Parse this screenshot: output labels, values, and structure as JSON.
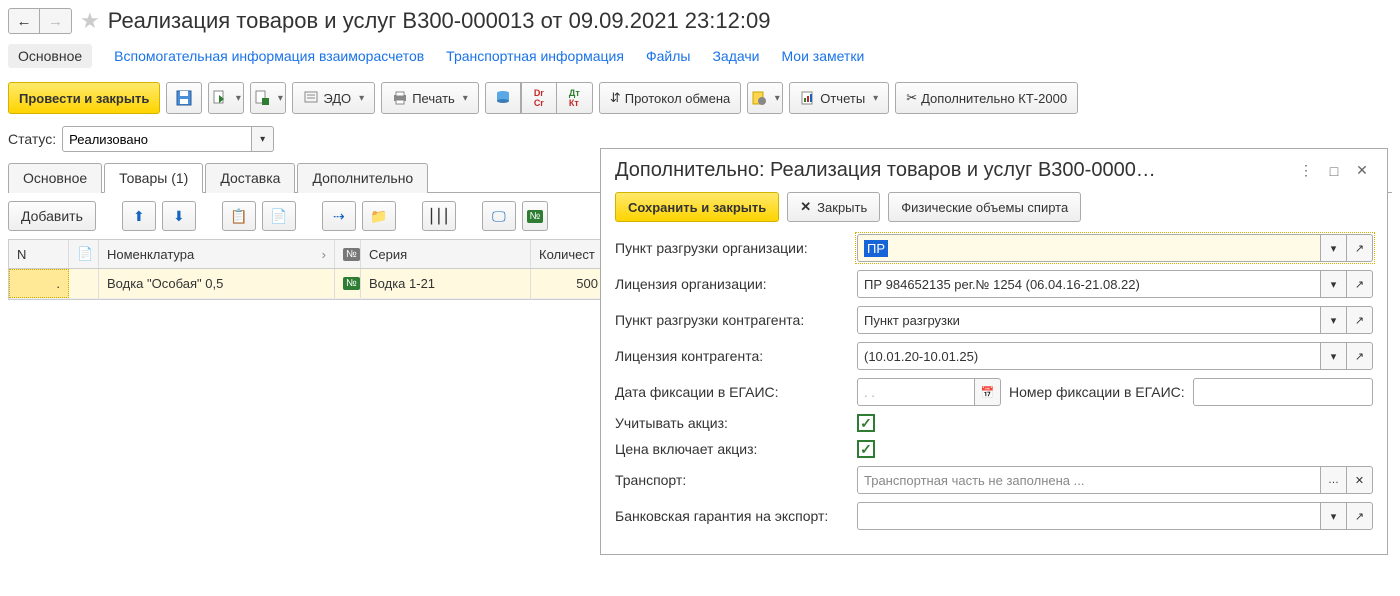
{
  "header": {
    "title": "Реализация товаров и услуг В300-000013 от 09.09.2021 23:12:09"
  },
  "linkTabs": {
    "main": "Основное",
    "aux": "Вспомогательная информация взаиморасчетов",
    "transport": "Транспортная информация",
    "files": "Файлы",
    "tasks": "Задачи",
    "notes": "Мои заметки"
  },
  "toolbar": {
    "postAndClose": "Провести и закрыть",
    "edo": "ЭДО",
    "print": "Печать",
    "protocol": "Протокол обмена",
    "reports": "Отчеты",
    "extKT": "Дополнительно КТ-2000"
  },
  "status": {
    "label": "Статус:",
    "value": "Реализовано"
  },
  "mainTabs": {
    "t1": "Основное",
    "t2": "Товары (1)",
    "t3": "Доставка",
    "t4": "Дополнительно"
  },
  "gridToolbar": {
    "add": "Добавить"
  },
  "gridHeader": {
    "n": "N",
    "nom": "Номенклатура",
    "ser": "Серия",
    "qty": "Количест"
  },
  "gridRow": {
    "n": ".",
    "nom": "Водка \"Особая\" 0,5",
    "ser": "Водка 1-21",
    "qty": "500"
  },
  "panel": {
    "title": "Дополнительно: Реализация товаров и услуг В300-0000…",
    "saveClose": "Сохранить и закрыть",
    "close": "Закрыть",
    "physVol": "Физические объемы спирта",
    "f1": {
      "label": "Пункт разгрузки организации:",
      "value": "ПР"
    },
    "f2": {
      "label": "Лицензия организации:",
      "value": "ПР 984652135 рег.№ 1254 (06.04.16-21.08.22)"
    },
    "f3": {
      "label": "Пункт разгрузки контрагента:",
      "value": "Пункт разгрузки"
    },
    "f4": {
      "label": "Лицензия контрагента:",
      "value": "(10.01.20-10.01.25)"
    },
    "f5": {
      "label": "Дата фиксации в ЕГАИС:",
      "value": "  .  .    "
    },
    "f5b": {
      "label": "Номер фиксации в ЕГАИС:",
      "value": ""
    },
    "f6": {
      "label": "Учитывать акциз:"
    },
    "f7": {
      "label": "Цена включает акциз:"
    },
    "f8": {
      "label": "Транспорт:",
      "value": "Транспортная часть не заполнена ..."
    },
    "f9": {
      "label": "Банковская гарантия на экспорт:",
      "value": ""
    }
  }
}
